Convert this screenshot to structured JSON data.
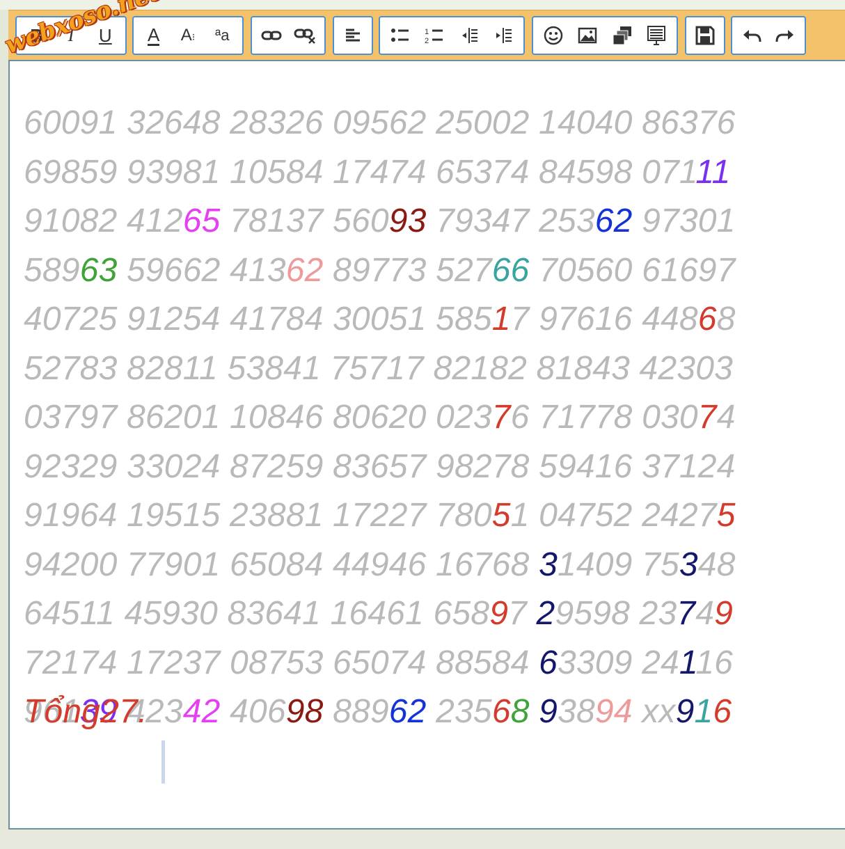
{
  "watermark": "webxoso.net",
  "toolbar": {
    "groups": [
      {
        "name": "text-style",
        "buttons": [
          "bold-icon",
          "italic-icon",
          "underline-icon"
        ]
      },
      {
        "name": "font",
        "buttons": [
          "font-color-icon",
          "font-size-icon",
          "font-face-icon"
        ]
      },
      {
        "name": "link",
        "buttons": [
          "link-icon",
          "unlink-icon"
        ]
      },
      {
        "name": "align",
        "buttons": [
          "align-left-icon"
        ]
      },
      {
        "name": "list",
        "buttons": [
          "bullet-list-icon",
          "numbered-list-icon",
          "outdent-icon",
          "indent-icon"
        ]
      },
      {
        "name": "insert",
        "buttons": [
          "emoji-icon",
          "image-icon",
          "gallery-icon",
          "table-icon"
        ]
      },
      {
        "name": "save",
        "buttons": [
          "save-icon"
        ]
      },
      {
        "name": "history",
        "buttons": [
          "undo-icon",
          "redo-icon"
        ]
      }
    ],
    "accent_color": "#f4c26b",
    "button_border_color": "#4e8fd1"
  },
  "editor": {
    "lines": [
      [
        {
          "t": "60091 32648 28326 09562 25002 14040 86376"
        }
      ],
      [
        {
          "t": "69859 93981 10584 17474 65374 84598 071"
        },
        {
          "t": "11",
          "c": "#7b2ff0"
        }
      ],
      [
        {
          "t": "91082 412"
        },
        {
          "t": "65",
          "c": "#e43ff0"
        },
        {
          "t": " 78137 560"
        },
        {
          "t": "93",
          "c": "#8a1a12"
        },
        {
          "t": " 79347 253"
        },
        {
          "t": "62",
          "c": "#1432d6"
        },
        {
          "t": " 97301"
        }
      ],
      [
        {
          "t": "589"
        },
        {
          "t": "63",
          "c": "#3fa33a"
        },
        {
          "t": " 59662 413"
        },
        {
          "t": "62",
          "c": "#ef9a9a"
        },
        {
          "t": " 89773 527"
        },
        {
          "t": "66",
          "c": "#3aa5a0"
        },
        {
          "t": " 70560 61697"
        }
      ],
      [
        {
          "t": "40725 91254 41784 30051 585"
        },
        {
          "t": "1",
          "c": "#d33b2c"
        },
        {
          "t": "7 97616 448"
        },
        {
          "t": "6",
          "c": "#d33b2c"
        },
        {
          "t": "8"
        }
      ],
      [
        {
          "t": "52783 82811 53841 75717 82182 81843 42303"
        }
      ],
      [
        {
          "t": "03797 86201 10846 80620 023"
        },
        {
          "t": "7",
          "c": "#d33b2c"
        },
        {
          "t": "6 71778 030"
        },
        {
          "t": "7",
          "c": "#d33b2c"
        },
        {
          "t": "4"
        }
      ],
      [
        {
          "t": "92329 33024 87259 83657 98278 59416 37124"
        }
      ],
      [
        {
          "t": "91964 19515 23881 17227 780"
        },
        {
          "t": "5",
          "c": "#d33b2c"
        },
        {
          "t": "1 04752 2427"
        },
        {
          "t": "5",
          "c": "#d33b2c"
        }
      ],
      [
        {
          "t": "94200 77901 65084 44946 16768 "
        },
        {
          "t": "3",
          "c": "#15186a"
        },
        {
          "t": "1409 75"
        },
        {
          "t": "3",
          "c": "#15186a"
        },
        {
          "t": "48"
        }
      ],
      [
        {
          "t": "64511 45930 83641 16461 658"
        },
        {
          "t": "9",
          "c": "#d33b2c"
        },
        {
          "t": "7 "
        },
        {
          "t": "2",
          "c": "#15186a"
        },
        {
          "t": "9598 23"
        },
        {
          "t": "7",
          "c": "#15186a"
        },
        {
          "t": "4"
        },
        {
          "t": "9",
          "c": "#d33b2c"
        }
      ],
      [
        {
          "t": "72174 17237 08753 65074 88584 "
        },
        {
          "t": "6",
          "c": "#15186a"
        },
        {
          "t": "3309 24"
        },
        {
          "t": "1",
          "c": "#15186a"
        },
        {
          "t": "16"
        }
      ],
      [
        {
          "t": "961"
        },
        {
          "t": "39",
          "c": "#7b2ff0"
        },
        {
          "t": " 423"
        },
        {
          "t": "42",
          "c": "#e43ff0"
        },
        {
          "t": " 406"
        },
        {
          "t": "98",
          "c": "#8a1a12"
        },
        {
          "t": " 889"
        },
        {
          "t": "62",
          "c": "#1432d6"
        },
        {
          "t": " 235"
        },
        {
          "t": "6",
          "c": "#d33b2c"
        },
        {
          "t": "8",
          "c": "#3fa33a"
        },
        {
          "t": " "
        },
        {
          "t": "9",
          "c": "#15186a"
        },
        {
          "t": "38"
        },
        {
          "t": "94",
          "c": "#ef9a9a"
        },
        {
          "t": " xx"
        },
        {
          "t": "9",
          "c": "#15186a"
        },
        {
          "t": "1",
          "c": "#3aa5a0"
        },
        {
          "t": "6",
          "c": "#d33b2c"
        }
      ]
    ],
    "footer_text": "Tổng27."
  }
}
